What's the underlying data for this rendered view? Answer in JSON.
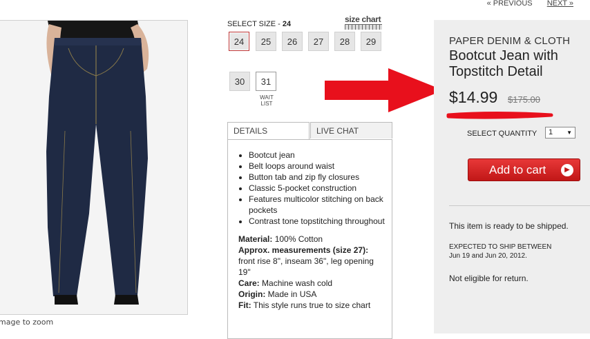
{
  "pager": {
    "prev_label": "« PREVIOUS",
    "next_label": "NEXT »"
  },
  "image": {
    "zoom_hint": "mage to zoom"
  },
  "sizes": {
    "label_prefix": "SELECT SIZE - ",
    "selected": "24",
    "chart_label": "size chart",
    "options": [
      "24",
      "25",
      "26",
      "27",
      "28",
      "29",
      "30",
      "31"
    ],
    "waitlist_label": "WAIT LIST"
  },
  "tabs": {
    "details": "DETAILS",
    "live_chat": "LIVE CHAT"
  },
  "details": {
    "bullets": [
      "Bootcut jean",
      "Belt loops around waist",
      "Button tab and zip fly closures",
      "Classic 5-pocket construction",
      "Features multicolor stitching on back pockets",
      "Contrast tone topstitching throughout"
    ],
    "specs": [
      {
        "key": "Material:",
        "value": " 100% Cotton"
      },
      {
        "key": "Approx. measurements (size 27):",
        "value": " front rise 8\", inseam 36\", leg opening 19\""
      },
      {
        "key": "Care:",
        "value": " Machine wash cold"
      },
      {
        "key": "Origin:",
        "value": " Made in USA"
      },
      {
        "key": "Fit:",
        "value": " This style runs true to size chart"
      }
    ]
  },
  "product": {
    "brand": "PAPER DENIM & CLOTH",
    "name": "Bootcut Jean with Topstitch Detail",
    "price": "$14.99",
    "old_price": "$175.00"
  },
  "quantity": {
    "label": "SELECT QUANTITY",
    "value": "1"
  },
  "cart": {
    "label": "Add to cart"
  },
  "shipping": {
    "ready": "This item is ready to be shipped.",
    "expected_title": "EXPECTED TO SHIP BETWEEN",
    "expected_dates": "Jun 19 and Jun 20, 2012.",
    "returns": "Not eligible for return."
  },
  "colors": {
    "accent_red": "#e8101c",
    "button_red": "#d42020",
    "panel_gray": "#eeeeee"
  }
}
